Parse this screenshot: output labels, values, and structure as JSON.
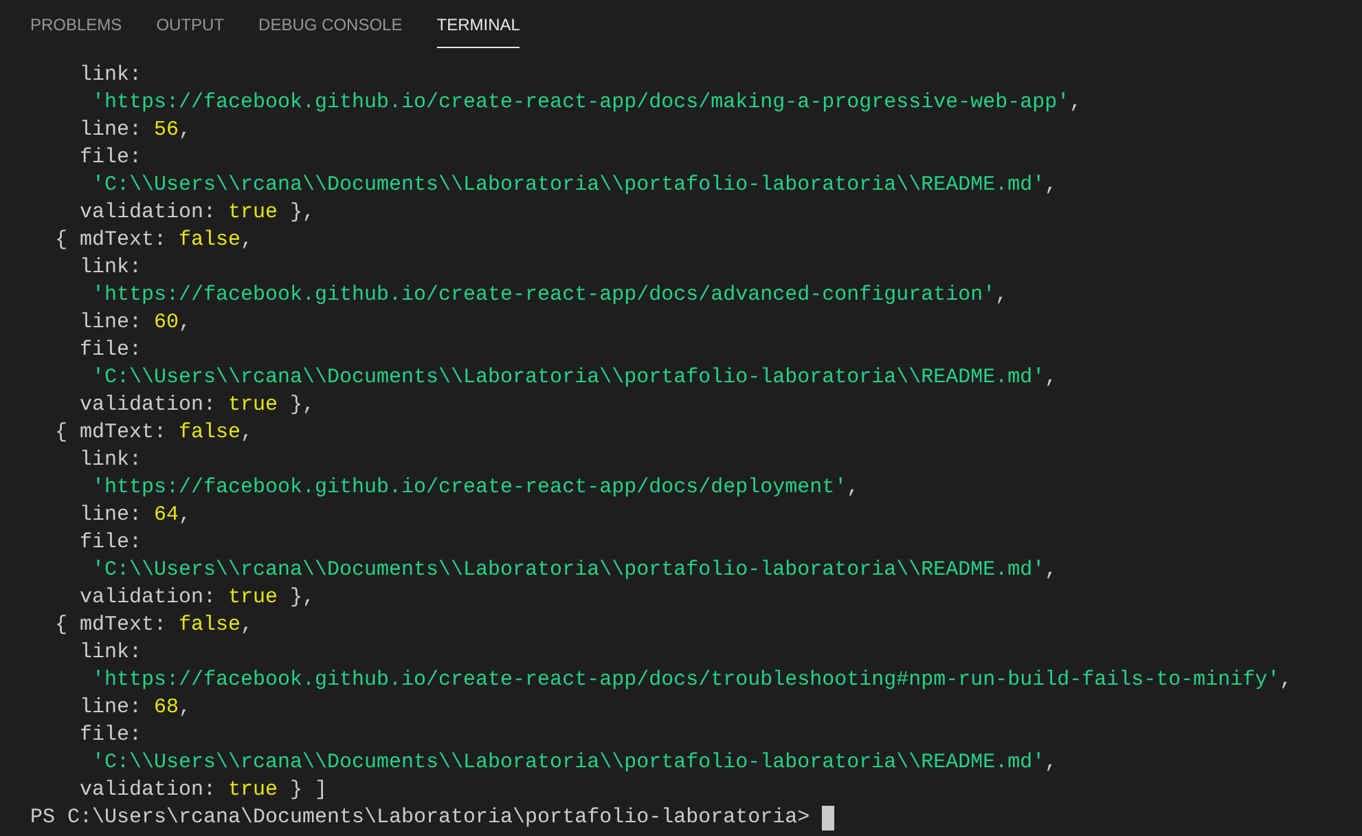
{
  "tabs": [
    {
      "label": "PROBLEMS",
      "selected": false
    },
    {
      "label": "OUTPUT",
      "selected": false
    },
    {
      "label": "DEBUG CONSOLE",
      "selected": false
    },
    {
      "label": "TERMINAL",
      "selected": true
    }
  ],
  "terminal": {
    "lines": [
      [
        {
          "kind": "text",
          "text": "    link:"
        }
      ],
      [
        {
          "kind": "string",
          "text": "     'https://facebook.github.io/create-react-app/docs/making-a-progressive-web-app'"
        },
        {
          "kind": "text",
          "text": ","
        }
      ],
      [
        {
          "kind": "text",
          "text": "    line: "
        },
        {
          "kind": "literal",
          "text": "56"
        },
        {
          "kind": "text",
          "text": ","
        }
      ],
      [
        {
          "kind": "text",
          "text": "    file:"
        }
      ],
      [
        {
          "kind": "string",
          "text": "     'C:\\\\Users\\\\rcana\\\\Documents\\\\Laboratoria\\\\portafolio-laboratoria\\\\README.md'"
        },
        {
          "kind": "text",
          "text": ","
        }
      ],
      [
        {
          "kind": "text",
          "text": "    validation: "
        },
        {
          "kind": "literal",
          "text": "true"
        },
        {
          "kind": "text",
          "text": " },"
        }
      ],
      [
        {
          "kind": "text",
          "text": "  { mdText: "
        },
        {
          "kind": "literal",
          "text": "false"
        },
        {
          "kind": "text",
          "text": ","
        }
      ],
      [
        {
          "kind": "text",
          "text": "    link:"
        }
      ],
      [
        {
          "kind": "string",
          "text": "     'https://facebook.github.io/create-react-app/docs/advanced-configuration'"
        },
        {
          "kind": "text",
          "text": ","
        }
      ],
      [
        {
          "kind": "text",
          "text": "    line: "
        },
        {
          "kind": "literal",
          "text": "60"
        },
        {
          "kind": "text",
          "text": ","
        }
      ],
      [
        {
          "kind": "text",
          "text": "    file:"
        }
      ],
      [
        {
          "kind": "string",
          "text": "     'C:\\\\Users\\\\rcana\\\\Documents\\\\Laboratoria\\\\portafolio-laboratoria\\\\README.md'"
        },
        {
          "kind": "text",
          "text": ","
        }
      ],
      [
        {
          "kind": "text",
          "text": "    validation: "
        },
        {
          "kind": "literal",
          "text": "true"
        },
        {
          "kind": "text",
          "text": " },"
        }
      ],
      [
        {
          "kind": "text",
          "text": "  { mdText: "
        },
        {
          "kind": "literal",
          "text": "false"
        },
        {
          "kind": "text",
          "text": ","
        }
      ],
      [
        {
          "kind": "text",
          "text": "    link:"
        }
      ],
      [
        {
          "kind": "string",
          "text": "     'https://facebook.github.io/create-react-app/docs/deployment'"
        },
        {
          "kind": "text",
          "text": ","
        }
      ],
      [
        {
          "kind": "text",
          "text": "    line: "
        },
        {
          "kind": "literal",
          "text": "64"
        },
        {
          "kind": "text",
          "text": ","
        }
      ],
      [
        {
          "kind": "text",
          "text": "    file:"
        }
      ],
      [
        {
          "kind": "string",
          "text": "     'C:\\\\Users\\\\rcana\\\\Documents\\\\Laboratoria\\\\portafolio-laboratoria\\\\README.md'"
        },
        {
          "kind": "text",
          "text": ","
        }
      ],
      [
        {
          "kind": "text",
          "text": "    validation: "
        },
        {
          "kind": "literal",
          "text": "true"
        },
        {
          "kind": "text",
          "text": " },"
        }
      ],
      [
        {
          "kind": "text",
          "text": "  { mdText: "
        },
        {
          "kind": "literal",
          "text": "false"
        },
        {
          "kind": "text",
          "text": ","
        }
      ],
      [
        {
          "kind": "text",
          "text": "    link:"
        }
      ],
      [
        {
          "kind": "string",
          "text": "     'https://facebook.github.io/create-react-app/docs/troubleshooting#npm-run-build-fails-to-minify'"
        },
        {
          "kind": "text",
          "text": ","
        }
      ],
      [
        {
          "kind": "text",
          "text": "    line: "
        },
        {
          "kind": "literal",
          "text": "68"
        },
        {
          "kind": "text",
          "text": ","
        }
      ],
      [
        {
          "kind": "text",
          "text": "    file:"
        }
      ],
      [
        {
          "kind": "string",
          "text": "     'C:\\\\Users\\\\rcana\\\\Documents\\\\Laboratoria\\\\portafolio-laboratoria\\\\README.md'"
        },
        {
          "kind": "text",
          "text": ","
        }
      ],
      [
        {
          "kind": "text",
          "text": "    validation: "
        },
        {
          "kind": "literal",
          "text": "true"
        },
        {
          "kind": "text",
          "text": " } ]"
        }
      ]
    ],
    "prompt": "PS C:\\Users\\rcana\\Documents\\Laboratoria\\portafolio-laboratoria> "
  }
}
